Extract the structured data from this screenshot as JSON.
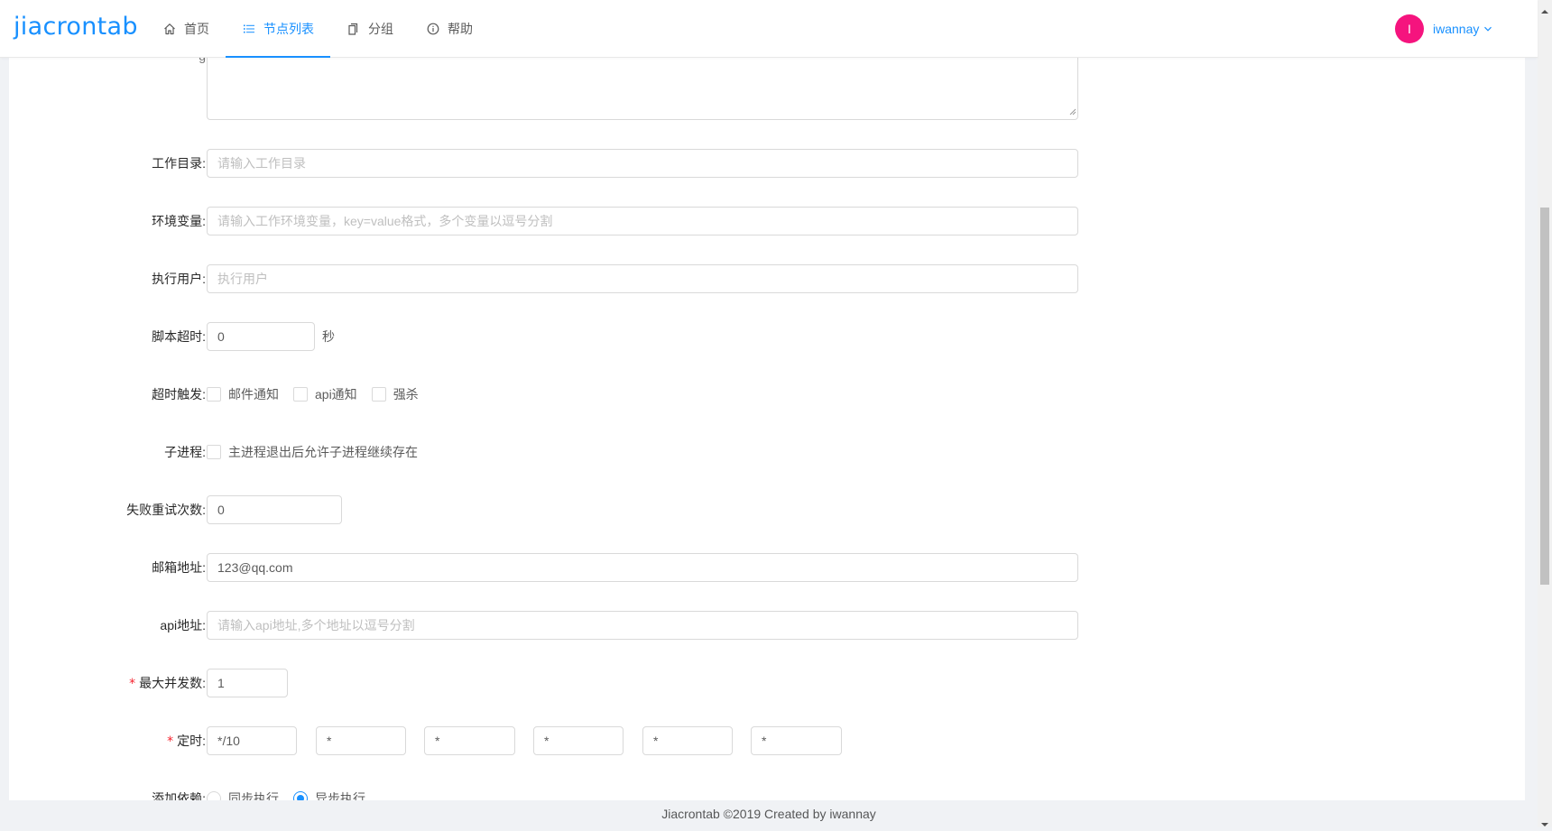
{
  "app": {
    "logo": "jiacrontab"
  },
  "nav": [
    {
      "icon": "home-icon",
      "label": "首页",
      "active": false
    },
    {
      "icon": "list-icon",
      "label": "节点列表",
      "active": true
    },
    {
      "icon": "copy-icon",
      "label": "分组",
      "active": false
    },
    {
      "icon": "info-circle-icon",
      "label": "帮助",
      "active": false
    }
  ],
  "user": {
    "avatar_letter": "I",
    "name": "iwannay",
    "avatar_color": "#f5147e"
  },
  "form": {
    "workdir": {
      "label": "工作目录:",
      "placeholder": "请输入工作目录"
    },
    "env": {
      "label": "环境变量:",
      "placeholder": "请输入工作环境变量，key=value格式，多个变量以逗号分割"
    },
    "user": {
      "label": "执行用户:",
      "placeholder": "执行用户"
    },
    "timeout": {
      "label": "脚本超时:",
      "value": "0",
      "unit": "秒"
    },
    "timeout_trigger": {
      "label": "超时触发:",
      "options": [
        "邮件通知",
        "api通知",
        "强杀"
      ]
    },
    "subprocess": {
      "label": "子进程:",
      "option": "主进程退出后允许子进程继续存在"
    },
    "retry": {
      "label": "失败重试次数:",
      "value": "0"
    },
    "email": {
      "label": "邮箱地址:",
      "value": "123@qq.com"
    },
    "api": {
      "label": "api地址:",
      "placeholder": "请输入api地址,多个地址以逗号分割"
    },
    "max_concurrent": {
      "label": "最大并发数:",
      "value": "1",
      "required": "*"
    },
    "timer": {
      "label": "定时:",
      "required": "*",
      "values": [
        "*/10",
        "*",
        "*",
        "*",
        "*",
        "*"
      ]
    },
    "dependency": {
      "label": "添加依赖:",
      "options": [
        "同步执行",
        "异步执行"
      ],
      "selected": 1
    }
  },
  "footer": {
    "text": "Jiacrontab ©2019 Created by iwannay"
  },
  "colors": {
    "primary": "#1890ff",
    "required": "#f5222d"
  }
}
